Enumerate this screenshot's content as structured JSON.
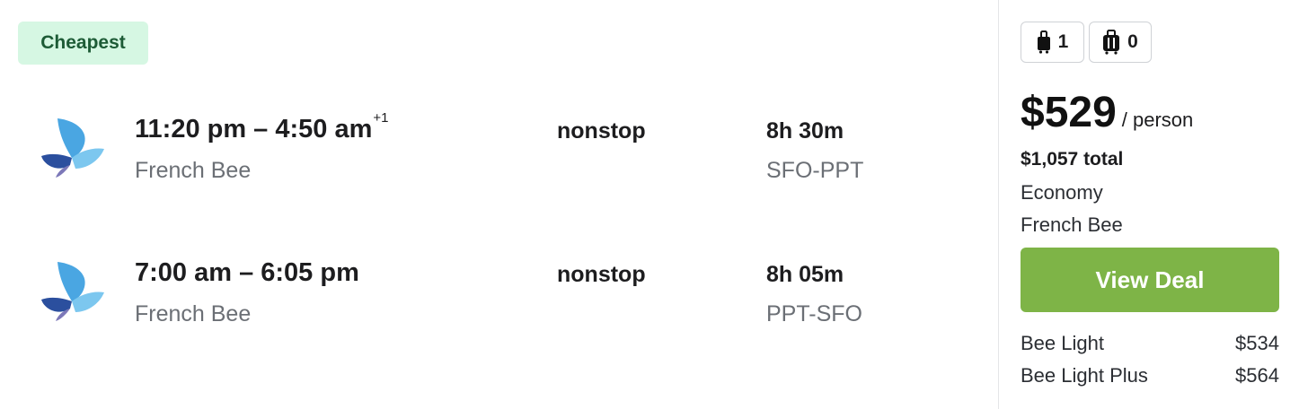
{
  "badge": "Cheapest",
  "legs": [
    {
      "times": "11:20 pm – 4:50 am",
      "day_offset": "+1",
      "airline": "French Bee",
      "stops": "nonstop",
      "duration": "8h 30m",
      "route": "SFO-PPT",
      "logo_icon": "french-bee-logo"
    },
    {
      "times": "7:00 am – 6:05 pm",
      "day_offset": "",
      "airline": "French Bee",
      "stops": "nonstop",
      "duration": "8h 05m",
      "route": "PPT-SFO",
      "logo_icon": "french-bee-logo"
    }
  ],
  "bags": {
    "carry_on": {
      "icon": "carry-on-bag-icon",
      "count": "1"
    },
    "checked": {
      "icon": "checked-bag-icon",
      "count": "0"
    }
  },
  "price": {
    "amount": "$529",
    "per": "/ person",
    "total": "$1,057 total",
    "cabin": "Economy",
    "provider": "French Bee"
  },
  "cta": {
    "label": "View Deal",
    "color": "#7eb447"
  },
  "fares": [
    {
      "name": "Bee Light",
      "price": "$534"
    },
    {
      "name": "Bee Light Plus",
      "price": "$564"
    }
  ],
  "colors": {
    "badge_bg": "#d6f7e3",
    "badge_text": "#1d5b36",
    "muted_text": "#6b6f75"
  }
}
